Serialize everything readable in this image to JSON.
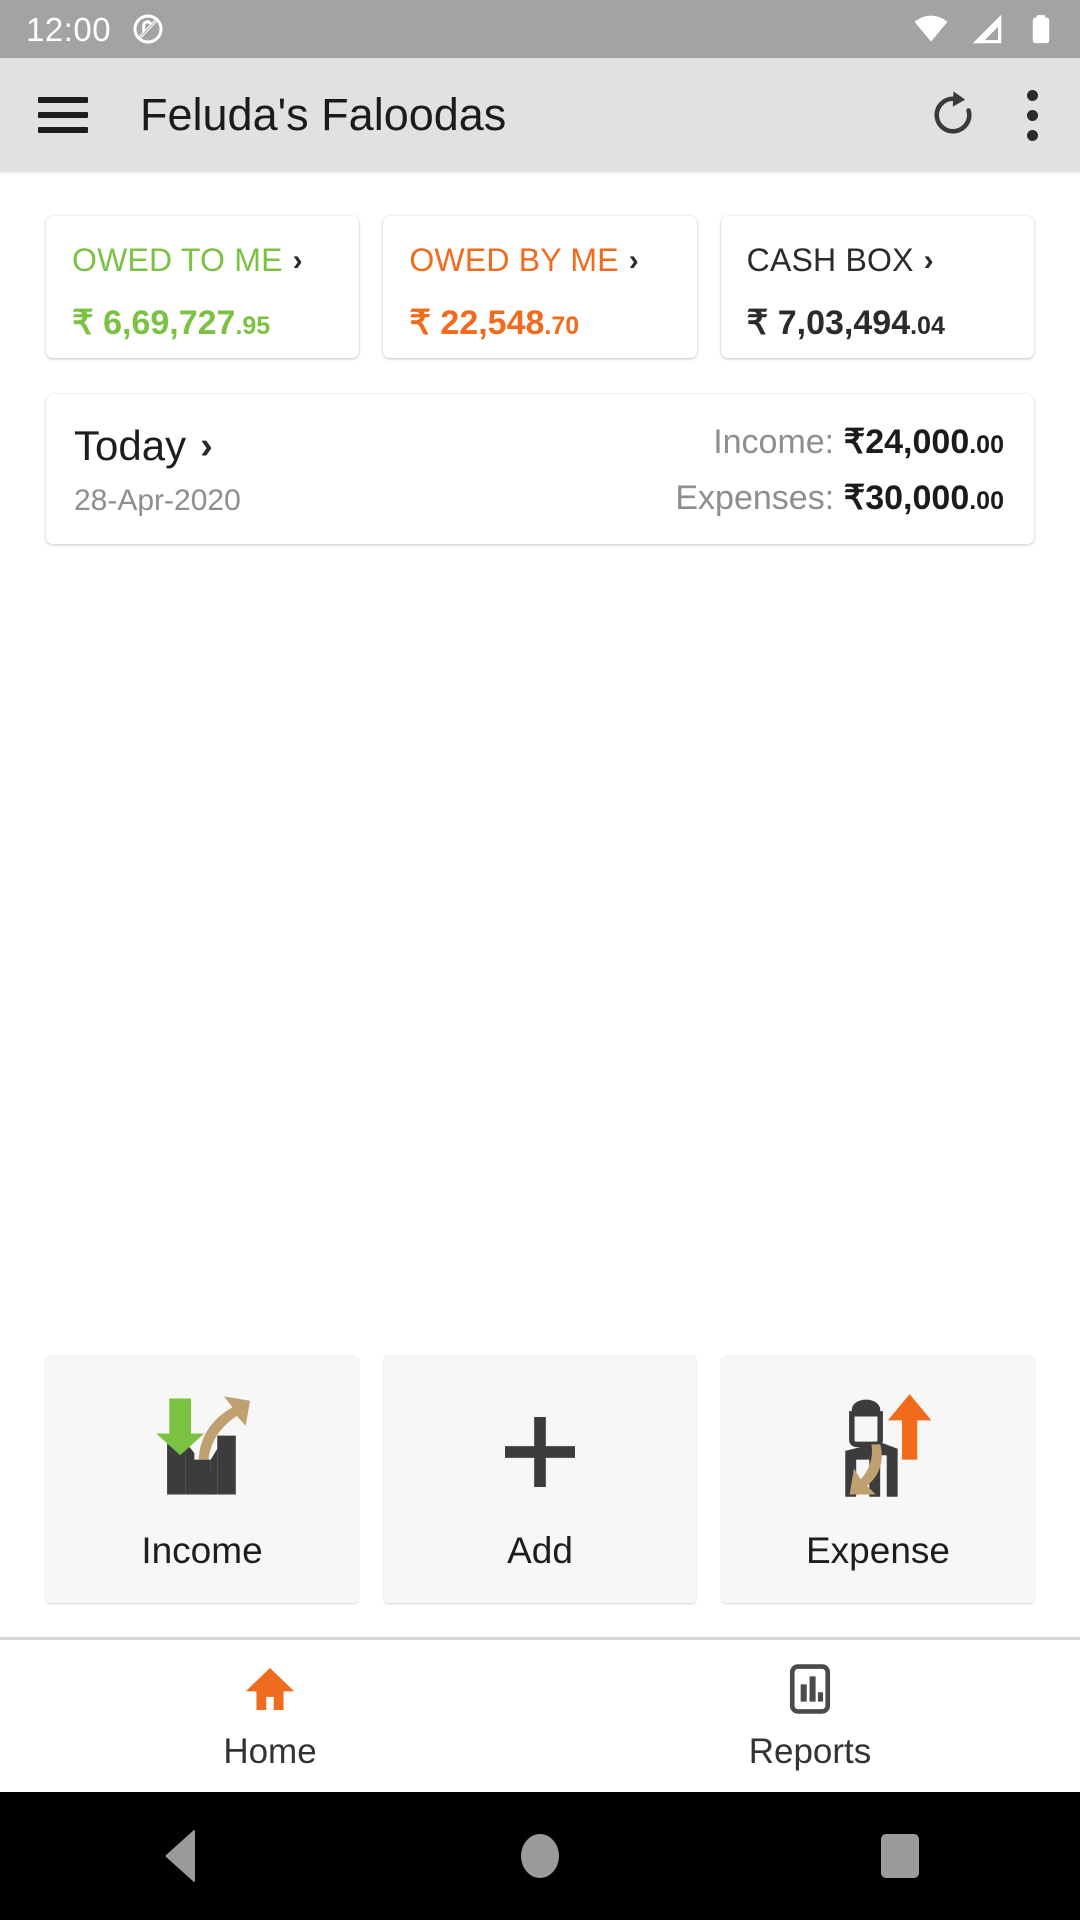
{
  "status_bar": {
    "time": "12:00",
    "icons": [
      "do-not-disturb-icon",
      "wifi-icon",
      "cellular-signal-icon",
      "battery-icon"
    ]
  },
  "app_bar": {
    "menu_icon": "hamburger-menu-icon",
    "title": "Feluda's Faloodas",
    "refresh_icon": "refresh-icon",
    "overflow_icon": "more-vertical-icon"
  },
  "summary_cards": [
    {
      "label": "OWED TO ME",
      "currency": "₹",
      "amount_main": "6,69,727",
      "amount_decimal": ".95",
      "color": "#7cc242"
    },
    {
      "label": "OWED BY ME",
      "currency": "₹",
      "amount_main": "22,548",
      "amount_decimal": ".70",
      "color": "#f26a1b"
    },
    {
      "label": "CASH BOX",
      "currency": "₹",
      "amount_main": "7,03,494",
      "amount_decimal": ".04",
      "color": "#2b2b2b"
    }
  ],
  "today_card": {
    "title": "Today",
    "date": "28-Apr-2020",
    "income_label": "Income:",
    "income_currency": "₹",
    "income_amount": "24,000",
    "income_decimal": ".00",
    "expenses_label": "Expenses:",
    "expenses_currency": "₹",
    "expenses_amount": "30,000",
    "expenses_decimal": ".00"
  },
  "actions": [
    {
      "label": "Income",
      "icon": "income-arrow-icon"
    },
    {
      "label": "Add",
      "icon": "plus-icon"
    },
    {
      "label": "Expense",
      "icon": "expense-arrow-icon"
    }
  ],
  "bottom_nav": [
    {
      "label": "Home",
      "icon": "home-icon",
      "active": true,
      "color": "#ef6c1f"
    },
    {
      "label": "Reports",
      "icon": "report-chart-icon",
      "active": false,
      "color": "#4a4a4a"
    }
  ],
  "system_nav": {
    "back": "back-triangle-icon",
    "home": "home-circle-icon",
    "recents": "recents-square-icon"
  }
}
